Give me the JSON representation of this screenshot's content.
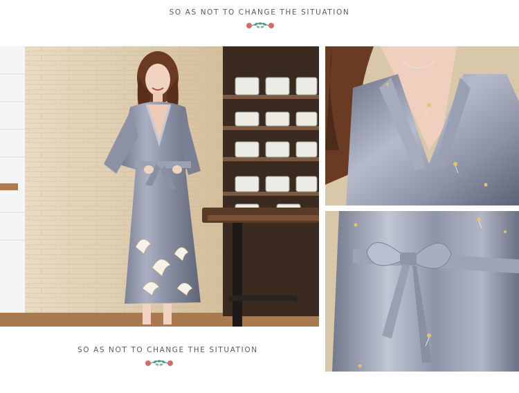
{
  "captions": {
    "top": "SO AS NOT TO CHANGE THE SITUATION",
    "bottom": "SO AS NOT TO CHANGE THE SITUATION"
  },
  "icons": {
    "ornament": "floral-ornament-icon"
  },
  "colors": {
    "robe": "#8f95a8",
    "robe_highlight": "#c3c8d6",
    "robe_shadow": "#5f6577",
    "wall": "#ddc9a7",
    "shelf": "#3a2a20",
    "ornament_pink": "#d66a6a",
    "ornament_green": "#4c9a80"
  }
}
